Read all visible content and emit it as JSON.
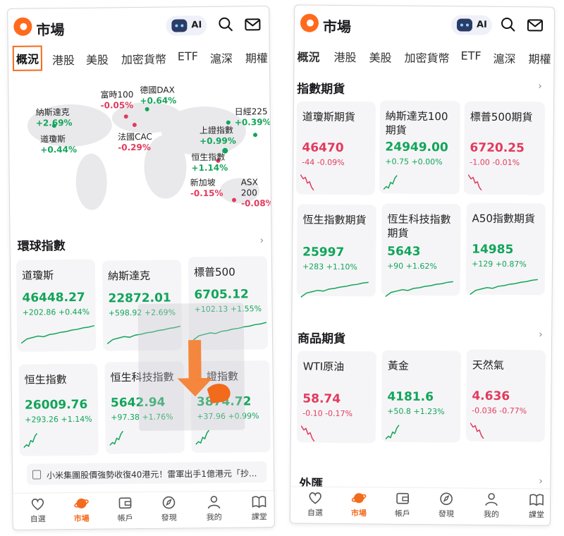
{
  "colors": {
    "accent": "#f36b1c",
    "up": "#12a55a",
    "down": "#e23a5c"
  },
  "header": {
    "title": "市場",
    "ai_label": "AI"
  },
  "tabs": [
    "概況",
    "港股",
    "美股",
    "加密貨幣",
    "ETF",
    "滬深",
    "期權"
  ],
  "map_indices": [
    {
      "name": "富時100",
      "value": "-0.05%",
      "dir": "down"
    },
    {
      "name": "德國DAX",
      "value": "+0.64%",
      "dir": "up"
    },
    {
      "name": "納斯達克",
      "value": "+2.69%",
      "dir": "up"
    },
    {
      "name": "日經225",
      "value": "+0.39%",
      "dir": "up"
    },
    {
      "name": "道瓊斯",
      "value": "+0.44%",
      "dir": "up"
    },
    {
      "name": "法國CAC",
      "value": "-0.29%",
      "dir": "down"
    },
    {
      "name": "上證指數",
      "value": "+0.99%",
      "dir": "up"
    },
    {
      "name": "恒生指數",
      "value": "+1.14%",
      "dir": "up"
    },
    {
      "name": "新加坡",
      "value": "-0.15%",
      "dir": "down"
    },
    {
      "name": "ASX 200",
      "value": "-0.08%",
      "dir": "down"
    }
  ],
  "global_indices": {
    "title": "環球指數",
    "cards": [
      {
        "name": "道瓊斯",
        "price": "46448.27",
        "change": "+202.86 +0.44%",
        "dir": "up"
      },
      {
        "name": "納斯達克",
        "price": "22872.01",
        "change": "+598.92 +2.69%",
        "dir": "up"
      },
      {
        "name": "標普500",
        "price": "6705.12",
        "change": "+102.13 +1.55%",
        "dir": "up"
      },
      {
        "name": "恒生指數",
        "price": "26009.76",
        "change": "+293.26 +1.14%",
        "dir": "up"
      },
      {
        "name": "恒生科技指數",
        "price": "5642.94",
        "change": "+97.38 +1.76%",
        "dir": "up"
      },
      {
        "name": "...證指數",
        "price": "3874.72",
        "change": "+37.96 +0.99%",
        "dir": "up"
      }
    ]
  },
  "news_ticker": "小米集團股價強勢收復40港元！雷軍出手1億港元「抄...",
  "index_futures": {
    "title": "指數期貨",
    "cards": [
      {
        "name": "道瓊斯期貨",
        "price": "46470",
        "change": "-44 -0.09%",
        "dir": "down"
      },
      {
        "name": "納斯達克100期貨",
        "price": "24949.00",
        "change": "+0.75 +0.00%",
        "dir": "up"
      },
      {
        "name": "標普500期貨",
        "price": "6720.25",
        "change": "-1.00 -0.01%",
        "dir": "down"
      },
      {
        "name": "恆生指數期貨",
        "price": "25997",
        "change": "+283 +1.10%",
        "dir": "up"
      },
      {
        "name": "恆生科技指數期貨",
        "price": "5643",
        "change": "+90 +1.62%",
        "dir": "up"
      },
      {
        "name": "A50指數期貨",
        "price": "14985",
        "change": "+129 +0.87%",
        "dir": "up"
      }
    ]
  },
  "commodity_futures": {
    "title": "商品期貨",
    "cards": [
      {
        "name": "WTI原油",
        "price": "58.74",
        "change": "-0.10 -0.17%",
        "dir": "down"
      },
      {
        "name": "黃金",
        "price": "4181.6",
        "change": "+50.8 +1.23%",
        "dir": "up"
      },
      {
        "name": "天然氣",
        "price": "4.636",
        "change": "-0.036 -0.77%",
        "dir": "down"
      }
    ]
  },
  "forex": {
    "title": "外匯"
  },
  "bottom_nav": [
    {
      "label": "自選",
      "icon": "heart-icon"
    },
    {
      "label": "市場",
      "icon": "planet-icon"
    },
    {
      "label": "帳戶",
      "icon": "wallet-icon"
    },
    {
      "label": "發現",
      "icon": "compass-icon"
    },
    {
      "label": "我的",
      "icon": "person-icon"
    },
    {
      "label": "課堂",
      "icon": "book-icon"
    }
  ]
}
